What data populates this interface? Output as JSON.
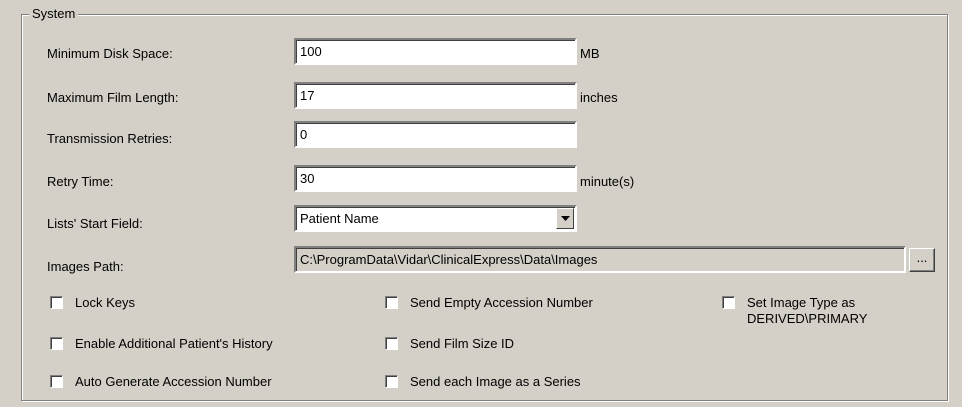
{
  "group": {
    "title": "System"
  },
  "fields": {
    "min_disk": {
      "label": "Minimum Disk Space:",
      "value": "100",
      "unit": "MB"
    },
    "max_film": {
      "label": "Maximum Film Length:",
      "value": "17",
      "unit": "inches"
    },
    "retries": {
      "label": "Transmission Retries:",
      "value": "0"
    },
    "retry_time": {
      "label": "Retry Time:",
      "value": "30",
      "unit": "minute(s)"
    },
    "start_field": {
      "label": "Lists' Start Field:",
      "value": "Patient Name"
    },
    "images_path": {
      "label": "Images Path:",
      "value": "C:\\ProgramData\\Vidar\\ClinicalExpress\\Data\\Images",
      "browse_label": "..."
    }
  },
  "checkboxes": {
    "lock_keys": {
      "label": "Lock Keys",
      "checked": false
    },
    "enable_history": {
      "label": "Enable Additional Patient's History",
      "checked": false
    },
    "auto_accession": {
      "label": "Auto Generate Accession Number",
      "checked": false
    },
    "send_empty_accession": {
      "label": "Send Empty Accession Number",
      "checked": false
    },
    "send_film_size": {
      "label": "Send Film Size ID",
      "checked": false
    },
    "send_each_image": {
      "label": "Send each Image as a Series",
      "checked": false
    },
    "set_image_type": {
      "label_line1": "Set Image Type as",
      "label_line2": "DERIVED\\PRIMARY",
      "checked": false
    }
  },
  "icons": {
    "dropdown": "chevron-down-icon"
  }
}
